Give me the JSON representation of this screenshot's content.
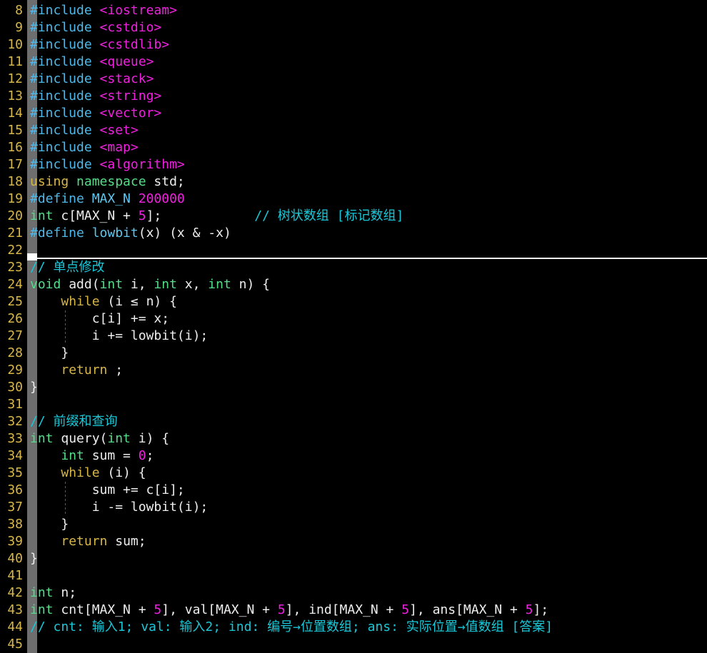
{
  "editor": {
    "kind": "terminal-code-editor",
    "language": "C++",
    "background": "#000000",
    "linenumber_color": "#d8b74a",
    "gutter_bar_color": "#6e6e6e",
    "thumb_color": "#ffffff",
    "first_line": 8,
    "last_line": 45,
    "colors": {
      "preprocessor": "#4fb8e8",
      "header": "#f020e0",
      "keyword": "#d8b74a",
      "type": "#56dd8a",
      "number": "#f020e0",
      "comment": "#19c8d8",
      "identifier": "#5fc8f0",
      "plain": "#eeeeee"
    }
  },
  "lines": [
    {
      "n": "8",
      "tokens": [
        {
          "t": "#include ",
          "c": "pp"
        },
        {
          "t": "<iostream>",
          "c": "hdr"
        }
      ]
    },
    {
      "n": "9",
      "tokens": [
        {
          "t": "#include ",
          "c": "pp"
        },
        {
          "t": "<cstdio>",
          "c": "hdr"
        }
      ]
    },
    {
      "n": "10",
      "tokens": [
        {
          "t": "#include ",
          "c": "pp"
        },
        {
          "t": "<cstdlib>",
          "c": "hdr"
        }
      ]
    },
    {
      "n": "11",
      "tokens": [
        {
          "t": "#include ",
          "c": "pp"
        },
        {
          "t": "<queue>",
          "c": "hdr"
        }
      ]
    },
    {
      "n": "12",
      "tokens": [
        {
          "t": "#include ",
          "c": "pp"
        },
        {
          "t": "<stack>",
          "c": "hdr"
        }
      ]
    },
    {
      "n": "13",
      "tokens": [
        {
          "t": "#include ",
          "c": "pp"
        },
        {
          "t": "<string>",
          "c": "hdr"
        }
      ]
    },
    {
      "n": "14",
      "tokens": [
        {
          "t": "#include ",
          "c": "pp"
        },
        {
          "t": "<vector>",
          "c": "hdr"
        }
      ]
    },
    {
      "n": "15",
      "tokens": [
        {
          "t": "#include ",
          "c": "pp"
        },
        {
          "t": "<set>",
          "c": "hdr"
        }
      ]
    },
    {
      "n": "16",
      "tokens": [
        {
          "t": "#include ",
          "c": "pp"
        },
        {
          "t": "<map>",
          "c": "hdr"
        }
      ]
    },
    {
      "n": "17",
      "tokens": [
        {
          "t": "#include ",
          "c": "pp"
        },
        {
          "t": "<algorithm>",
          "c": "hdr"
        }
      ]
    },
    {
      "n": "18",
      "tokens": [
        {
          "t": "using",
          "c": "kw"
        },
        {
          "t": " ",
          "c": "pl"
        },
        {
          "t": "namespace",
          "c": "typ"
        },
        {
          "t": " std;",
          "c": "pl"
        }
      ]
    },
    {
      "n": "19",
      "tokens": [
        {
          "t": "#define ",
          "c": "pp"
        },
        {
          "t": "MAX_N",
          "c": "id"
        },
        {
          "t": " ",
          "c": "pl"
        },
        {
          "t": "200000",
          "c": "num"
        }
      ]
    },
    {
      "n": "20",
      "tokens": [
        {
          "t": "int",
          "c": "typ"
        },
        {
          "t": " c[MAX_N + ",
          "c": "pl"
        },
        {
          "t": "5",
          "c": "num"
        },
        {
          "t": "];            ",
          "c": "pl"
        },
        {
          "t": "// 树状数组 [标记数组]",
          "c": "cmt"
        }
      ]
    },
    {
      "n": "21",
      "tokens": [
        {
          "t": "#define ",
          "c": "pp"
        },
        {
          "t": "lowbit",
          "c": "id"
        },
        {
          "t": "(x) (x & -x)",
          "c": "pl"
        }
      ]
    },
    {
      "n": "22",
      "tokens": []
    },
    {
      "n": "23",
      "tokens": [
        {
          "t": "// 单点修改",
          "c": "cmt"
        }
      ]
    },
    {
      "n": "24",
      "tokens": [
        {
          "t": "void",
          "c": "typ"
        },
        {
          "t": " add(",
          "c": "pl"
        },
        {
          "t": "int",
          "c": "typ"
        },
        {
          "t": " i, ",
          "c": "pl"
        },
        {
          "t": "int",
          "c": "typ"
        },
        {
          "t": " x, ",
          "c": "pl"
        },
        {
          "t": "int",
          "c": "typ"
        },
        {
          "t": " n) {",
          "c": "pl"
        }
      ]
    },
    {
      "n": "25",
      "guides": 0,
      "tokens": [
        {
          "t": "    ",
          "c": "pl"
        },
        {
          "t": "while",
          "c": "kw"
        },
        {
          "t": " (i ≤ n) {",
          "c": "pl"
        }
      ]
    },
    {
      "n": "26",
      "guides": 1,
      "tokens": [
        {
          "t": "        c[i] += x;",
          "c": "pl"
        }
      ]
    },
    {
      "n": "27",
      "guides": 1,
      "tokens": [
        {
          "t": "        i += lowbit(i);",
          "c": "pl"
        }
      ]
    },
    {
      "n": "28",
      "guides": 0,
      "tokens": [
        {
          "t": "    }",
          "c": "pl"
        }
      ]
    },
    {
      "n": "29",
      "guides": 0,
      "tokens": [
        {
          "t": "    ",
          "c": "pl"
        },
        {
          "t": "return",
          "c": "kw"
        },
        {
          "t": " ;",
          "c": "pl"
        }
      ]
    },
    {
      "n": "30",
      "tokens": [
        {
          "t": "}",
          "c": "pl"
        }
      ]
    },
    {
      "n": "31",
      "tokens": []
    },
    {
      "n": "32",
      "tokens": [
        {
          "t": "// 前缀和查询",
          "c": "cmt"
        }
      ]
    },
    {
      "n": "33",
      "tokens": [
        {
          "t": "int",
          "c": "typ"
        },
        {
          "t": " query(",
          "c": "pl"
        },
        {
          "t": "int",
          "c": "typ"
        },
        {
          "t": " i) {",
          "c": "pl"
        }
      ]
    },
    {
      "n": "34",
      "guides": 0,
      "tokens": [
        {
          "t": "    ",
          "c": "pl"
        },
        {
          "t": "int",
          "c": "typ"
        },
        {
          "t": " sum = ",
          "c": "pl"
        },
        {
          "t": "0",
          "c": "num"
        },
        {
          "t": ";",
          "c": "pl"
        }
      ]
    },
    {
      "n": "35",
      "guides": 0,
      "tokens": [
        {
          "t": "    ",
          "c": "pl"
        },
        {
          "t": "while",
          "c": "kw"
        },
        {
          "t": " (i) {",
          "c": "pl"
        }
      ]
    },
    {
      "n": "36",
      "guides": 1,
      "tokens": [
        {
          "t": "        sum += c[i];",
          "c": "pl"
        }
      ]
    },
    {
      "n": "37",
      "guides": 1,
      "tokens": [
        {
          "t": "        i -= lowbit(i);",
          "c": "pl"
        }
      ]
    },
    {
      "n": "38",
      "guides": 0,
      "tokens": [
        {
          "t": "    }",
          "c": "pl"
        }
      ]
    },
    {
      "n": "39",
      "guides": 0,
      "tokens": [
        {
          "t": "    ",
          "c": "pl"
        },
        {
          "t": "return",
          "c": "kw"
        },
        {
          "t": " sum;",
          "c": "pl"
        }
      ]
    },
    {
      "n": "40",
      "tokens": [
        {
          "t": "}",
          "c": "pl"
        }
      ]
    },
    {
      "n": "41",
      "tokens": []
    },
    {
      "n": "42",
      "tokens": [
        {
          "t": "int",
          "c": "typ"
        },
        {
          "t": " n;",
          "c": "pl"
        }
      ]
    },
    {
      "n": "43",
      "tokens": [
        {
          "t": "int",
          "c": "typ"
        },
        {
          "t": " cnt[MAX_N + ",
          "c": "pl"
        },
        {
          "t": "5",
          "c": "num"
        },
        {
          "t": "], val[MAX_N + ",
          "c": "pl"
        },
        {
          "t": "5",
          "c": "num"
        },
        {
          "t": "], ind[MAX_N + ",
          "c": "pl"
        },
        {
          "t": "5",
          "c": "num"
        },
        {
          "t": "], ans[MAX_N + ",
          "c": "pl"
        },
        {
          "t": "5",
          "c": "num"
        },
        {
          "t": "];",
          "c": "pl"
        }
      ]
    },
    {
      "n": "44",
      "tokens": [
        {
          "t": "// cnt: 输入1; val: 输入2; ind: 编号→位置数组; ans: 实际位置→值数组 [答案]",
          "c": "cmt"
        }
      ]
    },
    {
      "n": "45",
      "tokens": []
    }
  ]
}
